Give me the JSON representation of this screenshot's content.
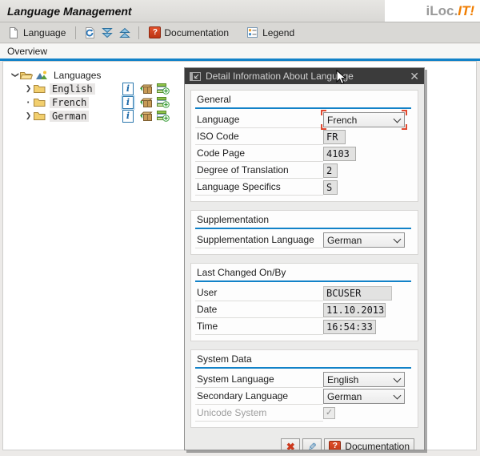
{
  "app": {
    "title": "Language Management",
    "logo_prefix": "iLoc.",
    "logo_suffix": "IT!"
  },
  "toolbar": {
    "language": "Language",
    "documentation": "Documentation",
    "legend": "Legend"
  },
  "tabs": {
    "overview": "Overview"
  },
  "tree": {
    "root_label": "Languages",
    "items": [
      {
        "label": "English",
        "state": "collapsed"
      },
      {
        "label": "French",
        "state": "leaf",
        "selected": true
      },
      {
        "label": "German",
        "state": "collapsed"
      }
    ]
  },
  "dialog": {
    "title": "Detail Information About Language",
    "general": {
      "heading": "General",
      "language": {
        "label": "Language",
        "value": "French"
      },
      "iso": {
        "label": "ISO Code",
        "value": "FR"
      },
      "codepage": {
        "label": "Code Page",
        "value": "4103"
      },
      "degree": {
        "label": "Degree of Translation",
        "value": "2"
      },
      "specifics": {
        "label": "Language Specifics",
        "value": "S"
      }
    },
    "supplementation": {
      "heading": "Supplementation",
      "language": {
        "label": "Supplementation Language",
        "value": "German"
      }
    },
    "last_changed": {
      "heading": "Last Changed On/By",
      "user": {
        "label": "User",
        "value": "BCUSER"
      },
      "date": {
        "label": "Date",
        "value": "11.10.2013"
      },
      "time": {
        "label": "Time",
        "value": "16:54:33"
      }
    },
    "system_data": {
      "heading": "System Data",
      "system_language": {
        "label": "System Language",
        "value": "English"
      },
      "secondary_language": {
        "label": "Secondary Language",
        "value": "German"
      },
      "unicode": {
        "label": "Unicode System",
        "checked": true
      }
    },
    "footer": {
      "documentation": "Documentation"
    }
  },
  "colors": {
    "accent_blue": "#1282c8",
    "brand_orange": "#f07d00",
    "alert_red": "#cc3a1e",
    "dialog_titlebar": "#3b3b3b"
  }
}
